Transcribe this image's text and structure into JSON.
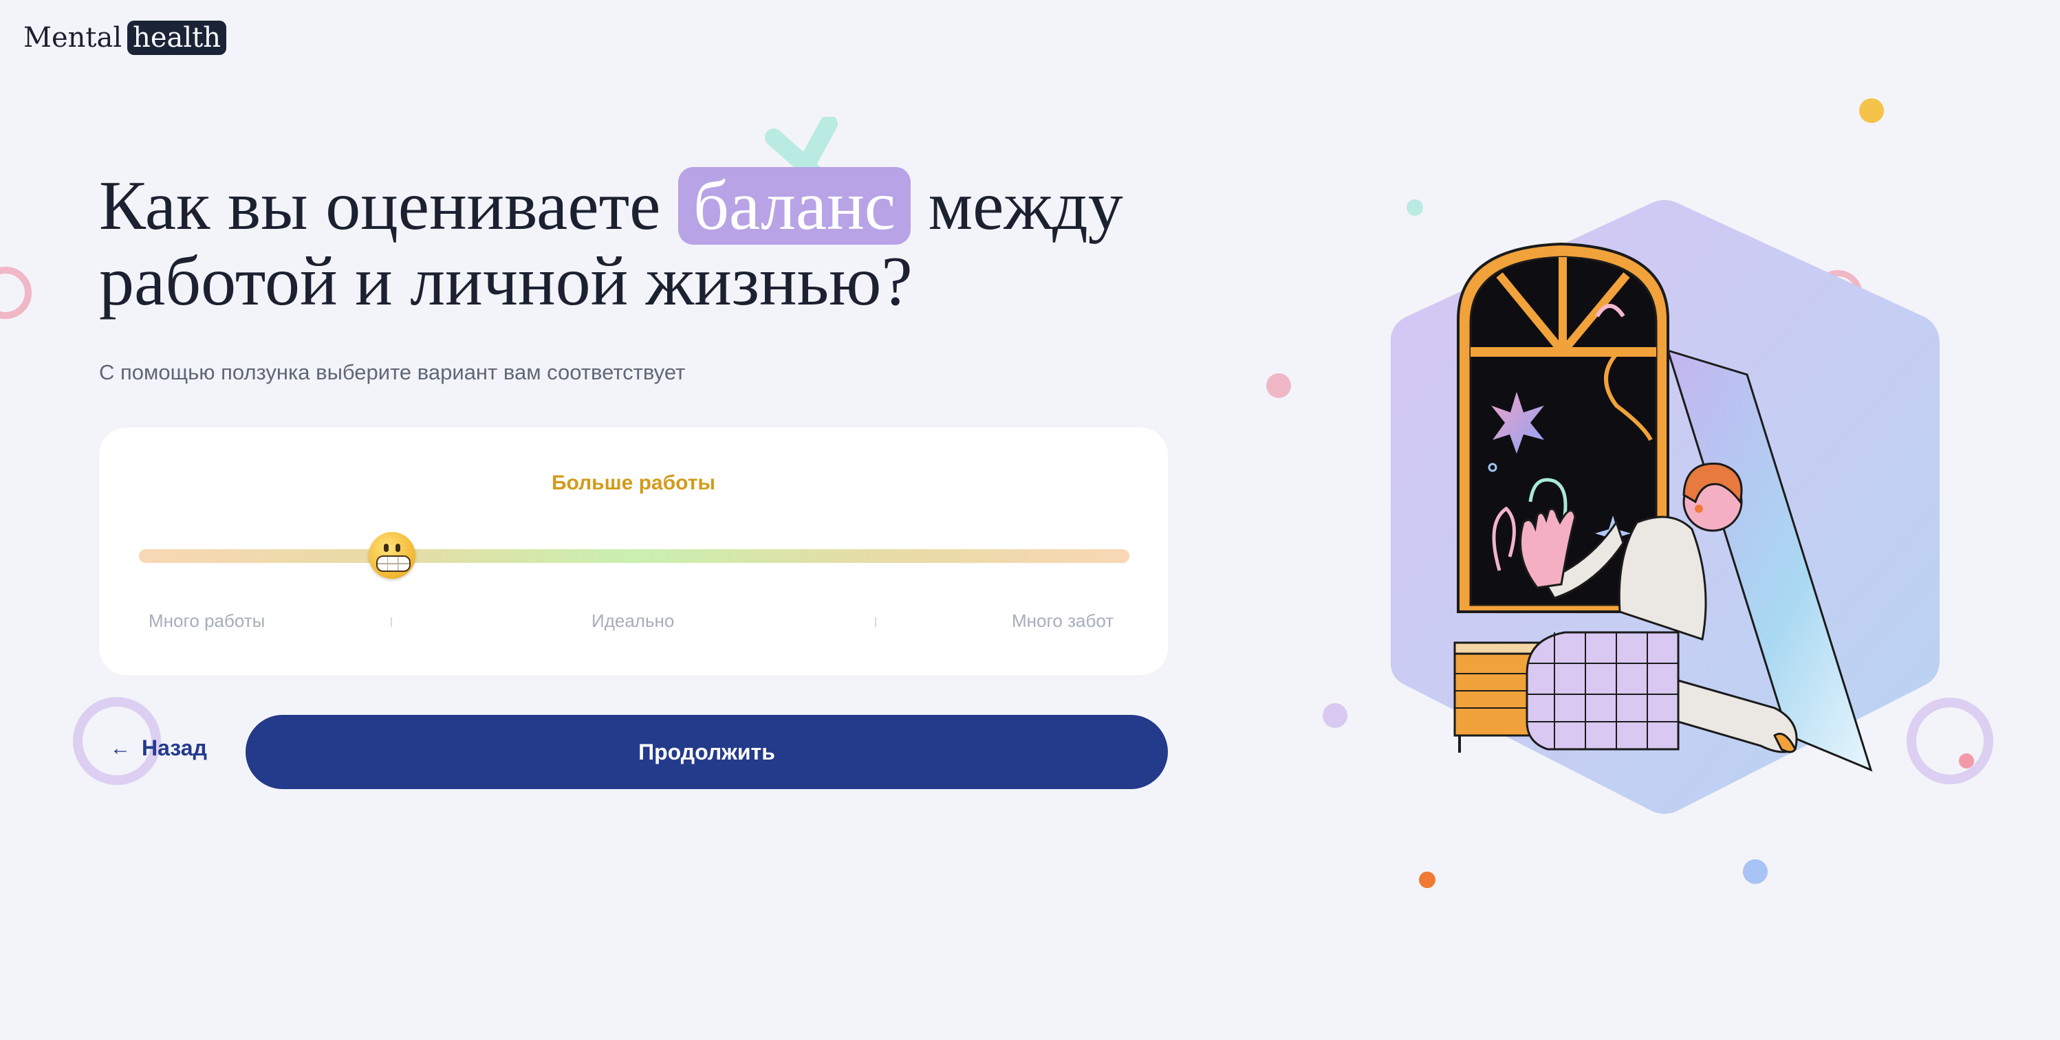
{
  "logo": {
    "part1": "Mental",
    "part2": "health"
  },
  "question": {
    "before": "Как вы оцениваете ",
    "accent": "баланс",
    "after": " между работой и личной жизнью?"
  },
  "subtitle": "С помощью ползунка выберите вариант вам соответствует",
  "slider": {
    "current_label": "Больше работы",
    "value_fraction": 0.26,
    "ticks": [
      "Много работы",
      "Идеально",
      "Много забот"
    ],
    "thumb_emoji": "grimacing-face"
  },
  "buttons": {
    "back": "Назад",
    "back_icon": "arrow-left-icon",
    "continue": "Продолжить"
  },
  "colors": {
    "primary": "#243a8b",
    "accent": "#b8a3e6",
    "value": "#d29b1c",
    "background": "#f3f4f9"
  }
}
